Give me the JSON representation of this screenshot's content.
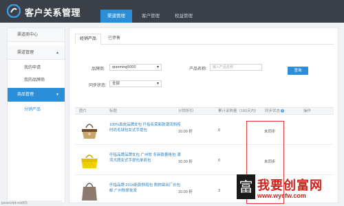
{
  "header": {
    "app_title": "客户关系管理",
    "nav_tabs": [
      "渠道管理",
      "客户管理",
      "权益管理"
    ]
  },
  "sidebar": {
    "items": [
      {
        "label": "渠道商中心"
      },
      {
        "label": "渠道管理",
        "caret": "▲"
      },
      {
        "label": "我的申请"
      },
      {
        "label": "我的品牌商"
      },
      {
        "label": "商品管理",
        "caret": "▼"
      },
      {
        "label": "分销产品"
      }
    ]
  },
  "main": {
    "tabs": [
      "经销产品",
      "已停售"
    ],
    "filters": {
      "brand_label": "品牌商:",
      "brand_value": "qianming5000",
      "product_name_label": "产品名称:",
      "product_name_placeholder": "输入产品名称",
      "sync_status_label": "同步状态:",
      "sync_status_value": "全部",
      "query_button": "查询"
    },
    "table": {
      "headers": [
        "图片",
        "标题",
        "分销折扣",
        "累计采购量（180天内）",
        "同步状态",
        "操作"
      ],
      "rows": [
        {
          "title": "100%真皮品牌女包 仟指名荣新款潮流斜挎时尚毛球包女式手提包",
          "discount": "10.00 折",
          "purchases": "0",
          "sync": "未同步"
        },
        {
          "title": "仟指品牌品牌女包 广州牧 冬新款菱格包 潮流大牌女式手提包单肩包",
          "discount": "10.00 折",
          "purchases": "0",
          "sync": "未同步"
        },
        {
          "title": "仟指品牌 2014新款斜挎包 购物袋出厂价包邮 广州牧原批发",
          "discount": "10.00 折",
          "purchases": "3",
          "sync": ""
        }
      ]
    }
  },
  "watermark": {
    "seal": "富",
    "text": "我要创富网",
    "url": "www.wycfw.com"
  },
  "statusbar": {
    "text": "javascript:void(0)"
  },
  "colors": {
    "header_bg": "#3b3f48",
    "accent": "#2a8fd8",
    "highlight_border": "#e53935",
    "watermark": "#d0201a"
  }
}
